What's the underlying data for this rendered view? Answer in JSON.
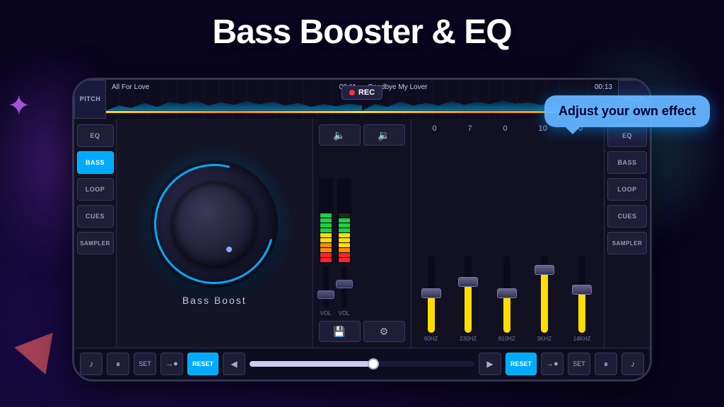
{
  "page": {
    "title": "Bass Booster & EQ"
  },
  "tooltip": {
    "text": "Adjust your own effect"
  },
  "waveform": {
    "left_track": "All For Love",
    "left_time": "00:11",
    "right_track": "Goodbye My Lover",
    "right_time": "00:13",
    "rec_label": "REC"
  },
  "left_sidebar": {
    "buttons": [
      {
        "label": "EQ",
        "active": false
      },
      {
        "label": "BASS",
        "active": true
      },
      {
        "label": "LOOP",
        "active": false
      },
      {
        "label": "CUES",
        "active": false
      },
      {
        "label": "SAMPLER",
        "active": false
      }
    ]
  },
  "right_sidebar": {
    "buttons": [
      {
        "label": "EQ",
        "active": false
      },
      {
        "label": "BASS",
        "active": false
      },
      {
        "label": "LOOP",
        "active": false
      },
      {
        "label": "CUES",
        "active": false
      },
      {
        "label": "SAMPLER",
        "active": false
      }
    ]
  },
  "knob": {
    "label": "Bass Boost"
  },
  "eq_values": [
    "0",
    "7",
    "0",
    "10",
    "0"
  ],
  "eq_freqs": [
    "60HZ",
    "230HZ",
    "910HZ",
    "3KHZ",
    "14KHZ"
  ],
  "eq_positions": [
    50,
    35,
    55,
    20,
    45
  ],
  "transport": {
    "set_label": "SET",
    "reset_label": "RESET"
  }
}
